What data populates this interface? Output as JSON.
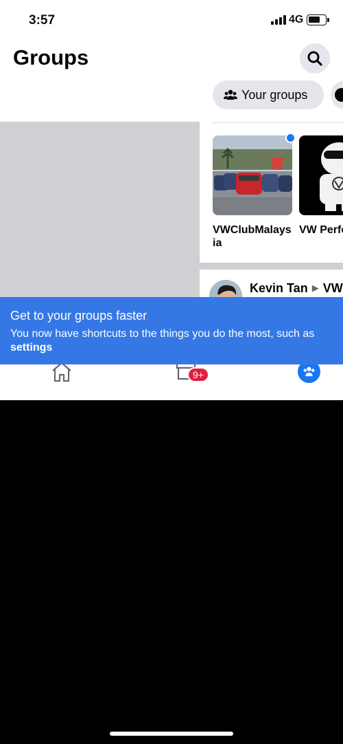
{
  "status_bar": {
    "time": "3:57",
    "network": "4G"
  },
  "header": {
    "title": "Groups"
  },
  "chips": [
    {
      "label": "Your groups",
      "icon": "groups-icon"
    }
  ],
  "groups": [
    {
      "name": "VWClubMalaysia",
      "has_unread": true
    },
    {
      "name": "VW Performa"
    }
  ],
  "post": {
    "author": "Kevin Tan",
    "group": "VWC"
  },
  "tabs": [
    {
      "name": "home-icon"
    },
    {
      "name": "marketplace-icon",
      "badge": "9+"
    },
    {
      "name": "groups-icon",
      "active": true
    }
  ],
  "banner": {
    "title": "Get to your groups faster",
    "body": "You now have shortcuts to the things you do the most, such as",
    "body_bold": "settings"
  },
  "colors": {
    "accent": "#1877f2",
    "banner": "#3578e5",
    "badge": "#e41e3f"
  }
}
